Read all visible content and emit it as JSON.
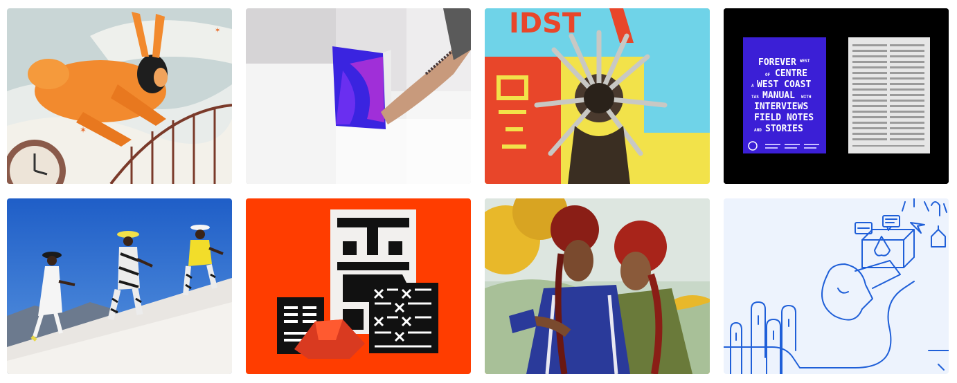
{
  "poster_text": {
    "w_line1": "FOREVER",
    "w_line1b": "WEST",
    "w_line2a": "OF",
    "w_line2": "CENTRE",
    "w_line3a": "A",
    "w_line3": "WEST COAST",
    "w_line4a": "TAS",
    "w_line4": "MANUAL",
    "w_line4b": "WITH",
    "w_line5": "INTERVIEWS",
    "w_line6": "FIELD NOTES",
    "w_line7a": "AND",
    "w_line7": "STORIES"
  },
  "colors": {
    "accent_purple": "#3b1fd6",
    "red_orange": "#ff3d00",
    "sky_blue": "#2a6fd6",
    "line_blue": "#1f5fd8"
  }
}
